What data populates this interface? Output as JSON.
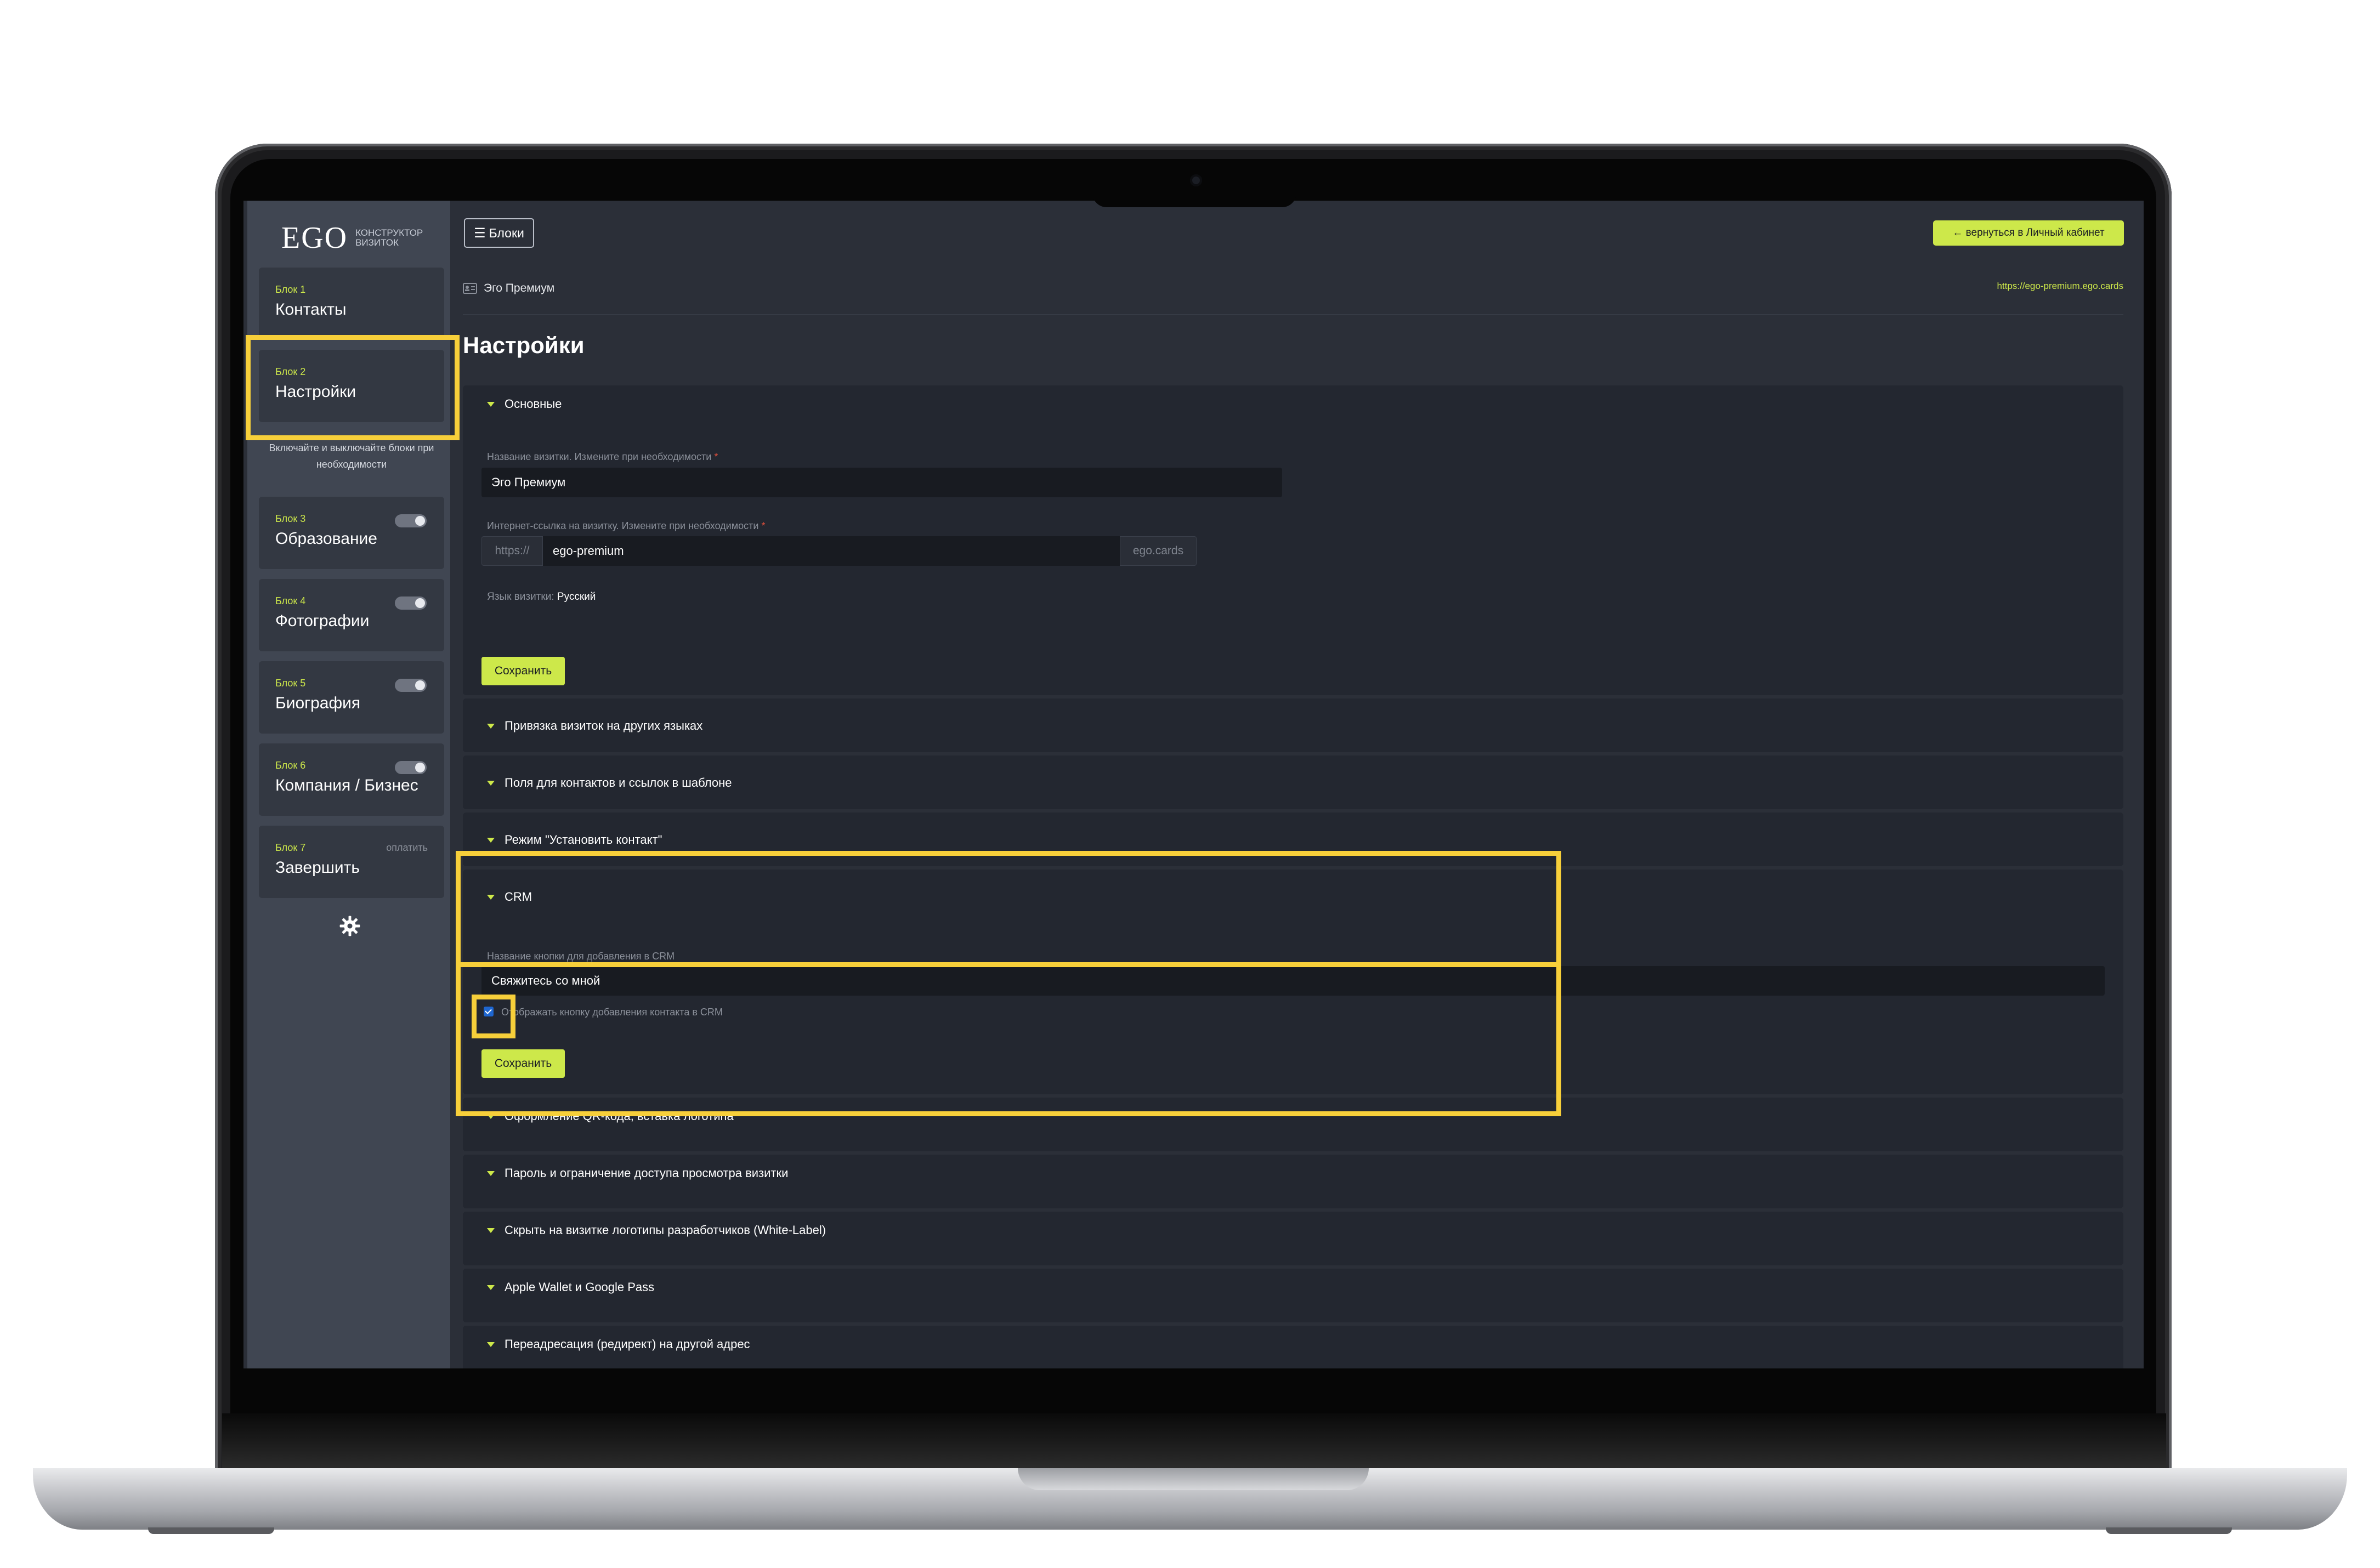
{
  "app": {
    "logo": "EGO",
    "logo_sub": "КОНСТРУКТОР ВИЗИТОК"
  },
  "topbar": {
    "blocks_button": "Блоки",
    "back_button": "← вернуться в Личный кабинет"
  },
  "breadcrumb": {
    "card_name": "Эго Премиум",
    "url": "https://ego-premium.ego.cards"
  },
  "page_title": "Настройки",
  "sidebar": {
    "blocks": [
      {
        "num": "Блок 1",
        "title": "Контакты"
      },
      {
        "num": "Блок 2",
        "title": "Настройки"
      },
      {
        "num": "Блок 3",
        "title": "Образование",
        "toggle": true
      },
      {
        "num": "Блок 4",
        "title": "Фотографии",
        "toggle": true
      },
      {
        "num": "Блок 5",
        "title": "Биография",
        "toggle": true
      },
      {
        "num": "Блок 6",
        "title": "Компания / Бизнес",
        "toggle": true
      },
      {
        "num": "Блок 7",
        "title": "Завершить",
        "badge": "оплатить"
      }
    ],
    "hint": "Включайте и выключайте блоки при необходимости",
    "settings_icon": "gear-icon"
  },
  "sections": {
    "basic": {
      "title": "Основные",
      "name_label": "Название визитки. Измените при необходимости",
      "name_value": "Эго Премиум",
      "link_label": "Интернет-ссылка на визитку. Измените при необходимости",
      "link_prefix": "https://",
      "link_value": "ego-premium",
      "link_suffix": "ego.cards",
      "lang_label": "Язык визитки:",
      "lang_value": "Русский",
      "save": "Сохранить"
    },
    "lang_link": {
      "title": "Привязка визиток на других языках"
    },
    "fields": {
      "title": "Поля для контактов и ссылок в шаблоне"
    },
    "mode": {
      "title": "Режим \"Установить контакт\""
    },
    "crm": {
      "title": "CRM",
      "button_label": "Название кнопки для добавления в CRM",
      "button_value": "Свяжитесь со мной",
      "checkbox_label": "Отображать кнопку добавления контакта в CRM",
      "checkbox_checked": true,
      "save": "Сохранить"
    },
    "qr": {
      "title": "Оформление QR-кода, вставка логотипа"
    },
    "password": {
      "title": "Пароль и ограничение доступа просмотра визитки"
    },
    "whitelabel": {
      "title": "Скрыть на визитке логотипы разработчиков (White-Label)"
    },
    "wallet": {
      "title": "Apple Wallet и Google Pass"
    },
    "redirect": {
      "title": "Переадресация (редирект) на другой адрес"
    }
  },
  "colors": {
    "accent": "#cde84a",
    "highlight": "#f7cf3a",
    "background": "#2b2f38",
    "sidebar": "#404652"
  }
}
